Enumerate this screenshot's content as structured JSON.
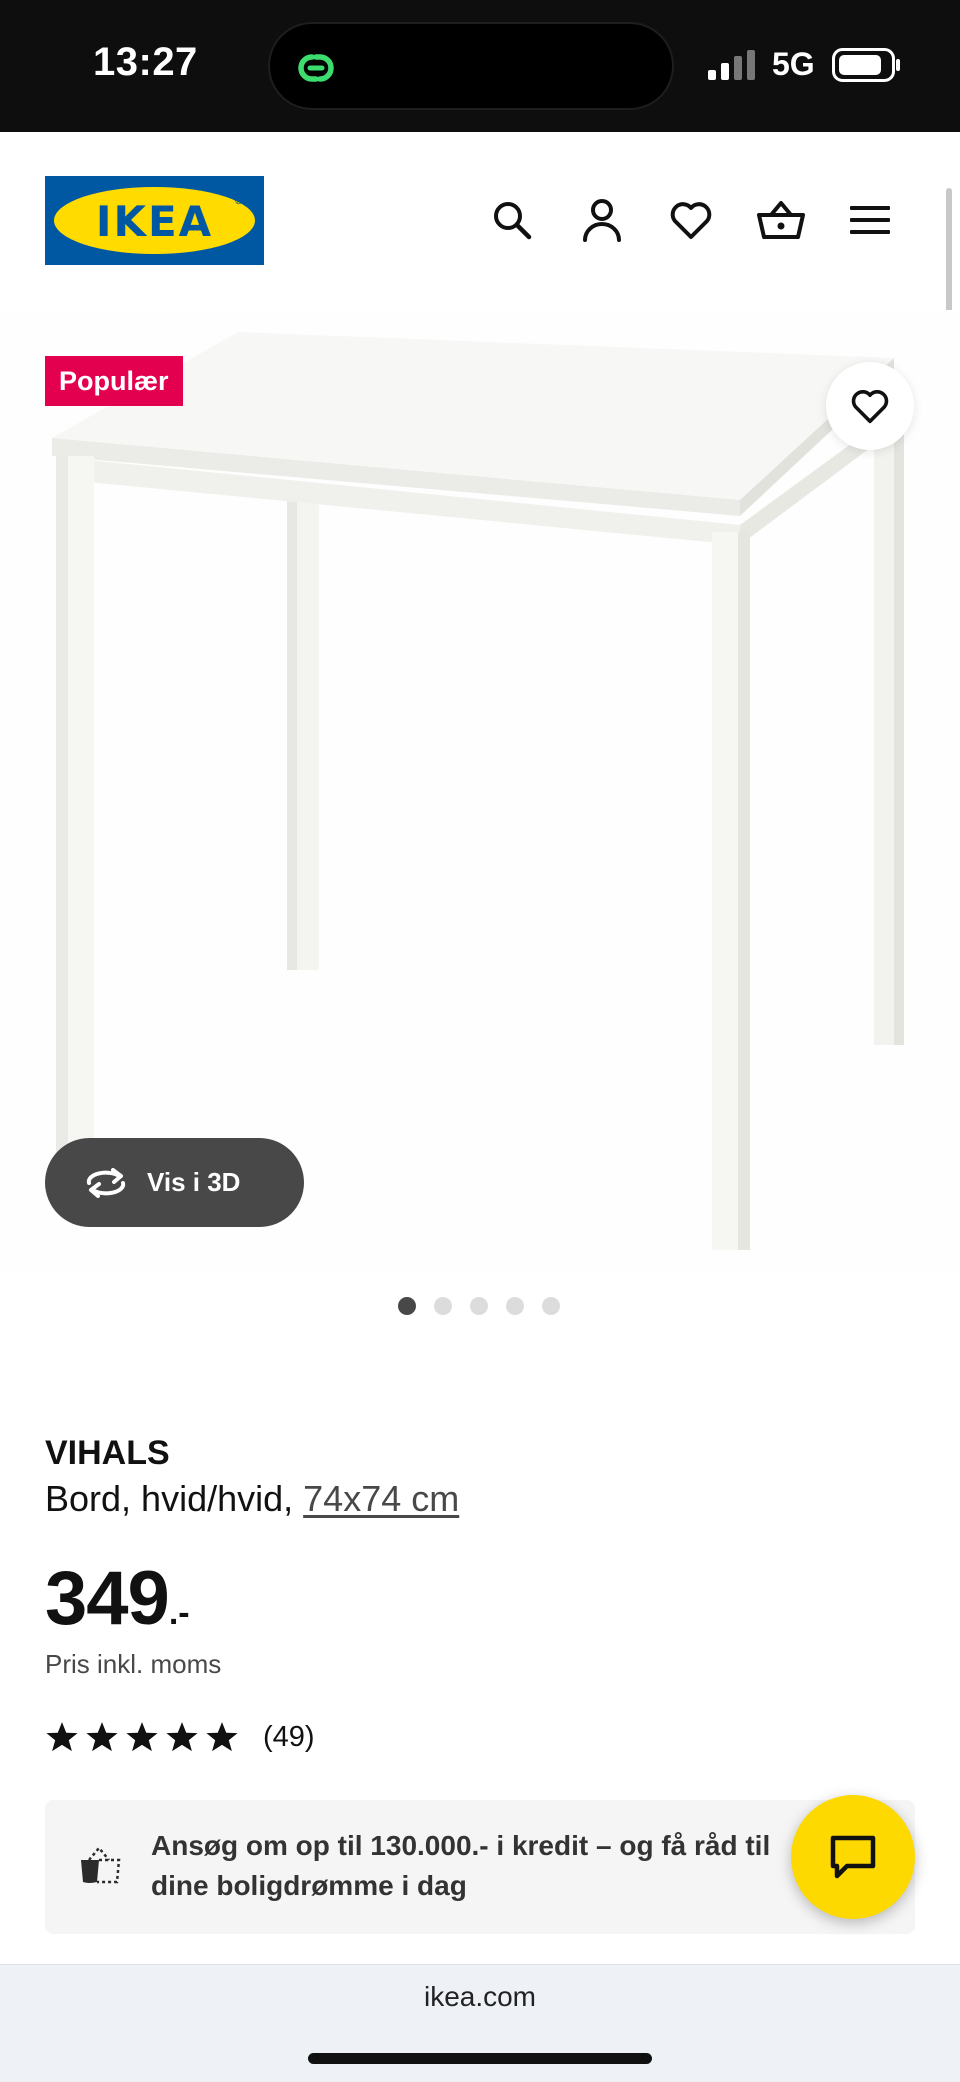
{
  "status_bar": {
    "time": "13:27",
    "network": "5G",
    "island_icon": "chain-link-icon"
  },
  "header": {
    "logo_text": "IKEA",
    "logo_reg": "®",
    "icons": [
      "search-icon",
      "account-icon",
      "favourites-heart-icon",
      "shopping-basket-icon",
      "menu-icon"
    ]
  },
  "gallery": {
    "badge": "Populær",
    "view_3d_label": "Vis i 3D",
    "image_count": 5,
    "active_image": 1
  },
  "product": {
    "name": "VIHALS",
    "description": "Bord, hvid/hvid,",
    "size_link": "74x74 cm",
    "price": "349",
    "price_suffix": ".-",
    "vat_note": "Pris inkl. moms",
    "rating_stars": 5,
    "review_count": "(49)"
  },
  "credit_banner": {
    "text": "Ansøg om op til 130.000.- i kredit – og få råd til dine boligdrømme i dag"
  },
  "browser": {
    "url": "ikea.com"
  },
  "colors": {
    "brand_blue": "#0058a3",
    "brand_yellow": "#ffdb00",
    "badge_red": "#e3004f",
    "chat_yellow": "#fdd900",
    "dark_button": "#484848"
  }
}
